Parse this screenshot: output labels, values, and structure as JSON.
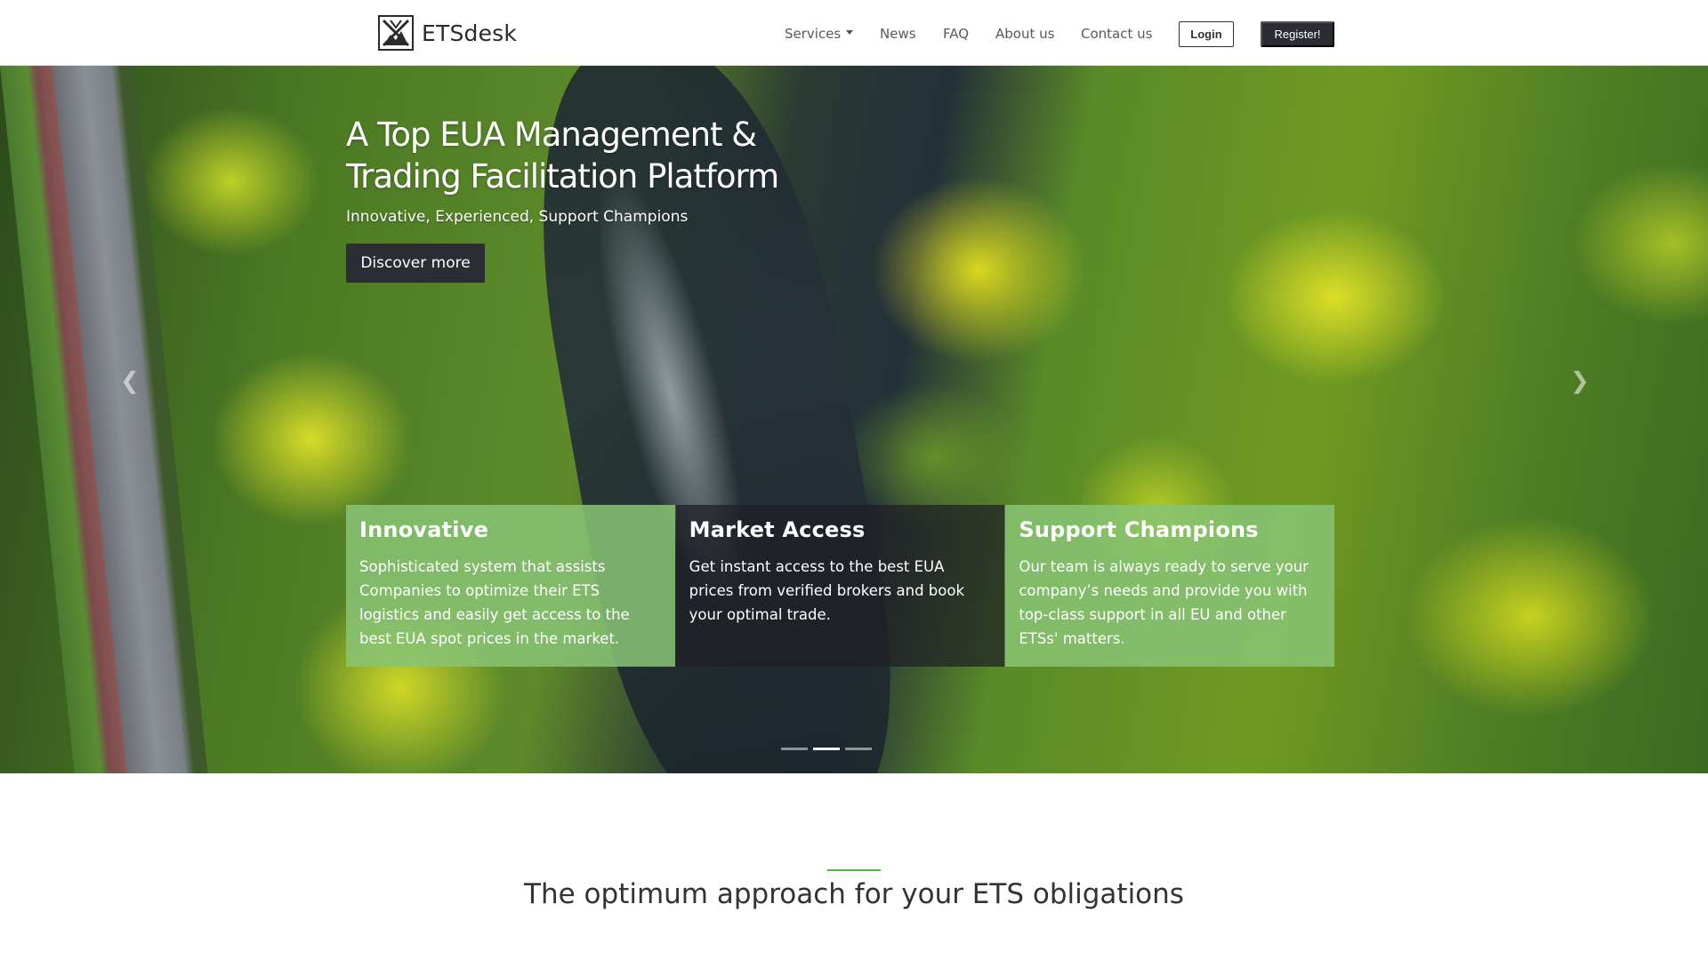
{
  "brand": {
    "name": "ETSdesk",
    "logo_icon": "mountain-x-logo"
  },
  "nav": {
    "items": [
      {
        "label": "Services",
        "has_dropdown": true
      },
      {
        "label": "News"
      },
      {
        "label": "FAQ"
      },
      {
        "label": "About us"
      },
      {
        "label": "Contact us"
      }
    ],
    "login_label": "Login",
    "register_label": "Register!"
  },
  "hero": {
    "title": "A Top EUA Management & Trading Facilitation Platform",
    "subtitle": "Innovative, Experienced, Support Champions",
    "cta_label": "Discover more",
    "prev_icon": "chevron-left-icon",
    "next_icon": "chevron-right-icon",
    "slides_count": 3,
    "active_slide": 2,
    "cards": [
      {
        "title": "Innovative",
        "text": "Sophisticated system that assists Companies to optimize their ETS logistics and easily get access to the best EUA spot prices in the market.",
        "style": "green"
      },
      {
        "title": "Market Access",
        "text": "Get instant access to the best EUA prices from verified brokers and book your optimal trade.",
        "style": "dark"
      },
      {
        "title": "Support Champions",
        "text": "Our team is always ready to serve your company’s needs and provide you with top-class support in all EU and other ETSs' matters.",
        "style": "green"
      }
    ]
  },
  "section": {
    "title": "The optimum approach for your ETS obligations",
    "accent_color": "#58b04a"
  },
  "colors": {
    "dark_button": "#2b2d35",
    "card_green": "#88c474"
  }
}
